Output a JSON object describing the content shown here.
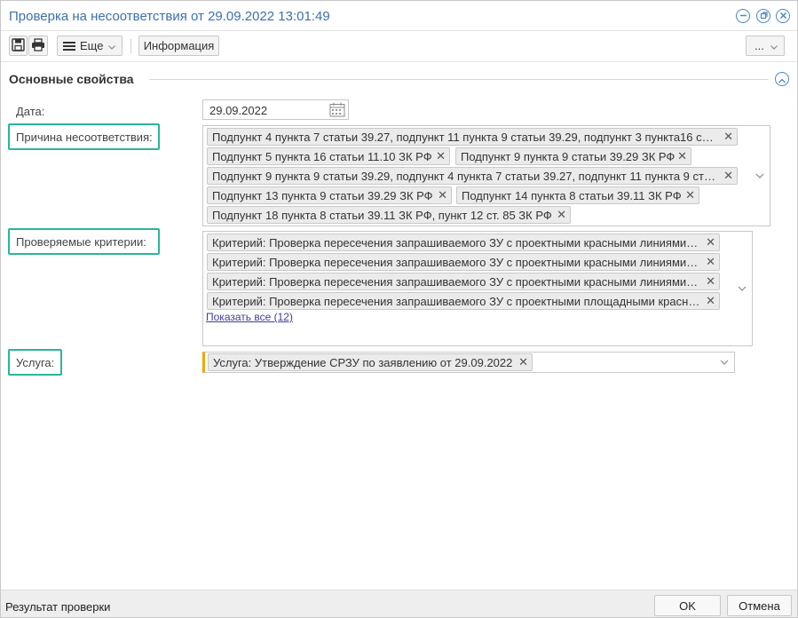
{
  "window": {
    "title": "Проверка на несоответствия от 29.09.2022 13:01:49",
    "controls": [
      "minimize-icon",
      "restore-icon",
      "close-icon"
    ]
  },
  "toolbar": {
    "save_icon": "save-icon",
    "print_icon": "print-icon",
    "more_label": "Еще",
    "info_label": "Информация",
    "extra_label": "..."
  },
  "section": {
    "title": "Основные свойства"
  },
  "fields": {
    "date_label": "Дата:",
    "date_value": "29.09.2022",
    "reason_label": "Причина несоответствия:",
    "reason_tags": [
      "Подпункт 4 пункта 7 статьи 39.27, подпункт 11 пункта 9 статьи 39.29, подпункт 3 пункта16 с…",
      "Подпункт 5 пункта 16 статьи 11.10 ЗК РФ",
      "Подпункт 9 пункта 9 статьи 39.29 ЗК РФ",
      "Подпункт 9 пункта 9 статьи 39.29, подпункт 4 пункта 7 статьи 39.27, подпункт 11 пункта 9 ст…",
      "Подпункт 13 пункта 9 статьи 39.29 ЗК РФ",
      "Подпункт 14 пункта 8 статьи 39.11 ЗК РФ",
      "Подпункт 18 пункта 8 статьи 39.11 ЗК РФ, пункт 12 ст. 85 ЗК РФ"
    ],
    "criteria_label": "Проверяемые критерии:",
    "criteria_tags": [
      "Критерий: Проверка пересечения запрашиваемого ЗУ с проектными красными линиями…",
      "Критерий: Проверка пересечения запрашиваемого ЗУ с проектными красными линиями…",
      "Критерий: Проверка пересечения запрашиваемого ЗУ с проектными красными линиями…",
      "Критерий: Проверка пересечения запрашиваемого ЗУ с проектными площадными красн…"
    ],
    "criteria_show_all": "Показать все (12)",
    "service_label": "Услуга:",
    "service_tag": "Услуга: Утверждение СРЗУ по заявлению от 29.09.2022"
  },
  "footer": {
    "title": "Результат проверки",
    "ok_label": "OK",
    "cancel_label": "Отмена"
  },
  "colors": {
    "title": "#3d6fb0",
    "highlight": "#2bb59a",
    "required_marker": "#f0a800"
  }
}
